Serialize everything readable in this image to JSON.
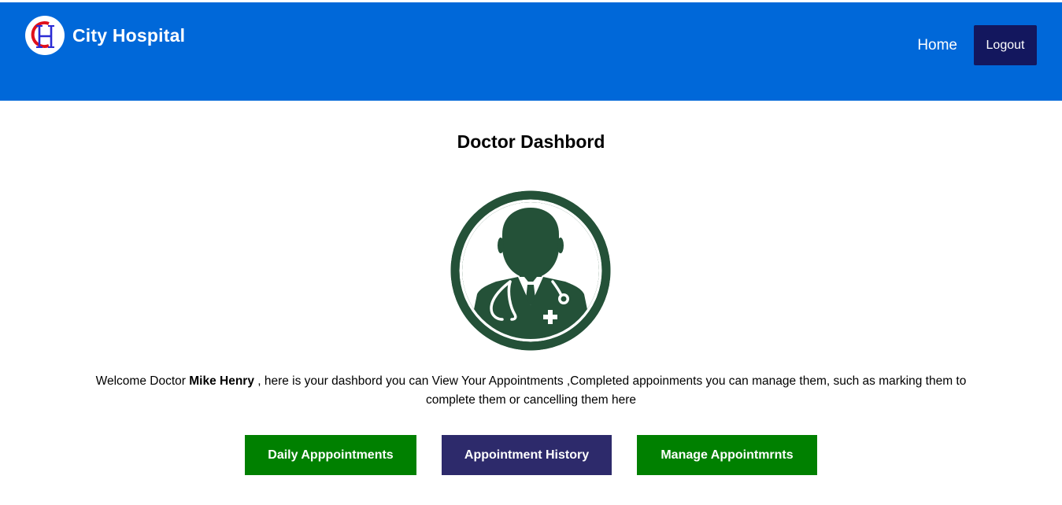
{
  "colors": {
    "navbar": "#0068d9",
    "logout_bg": "#13175e",
    "avatar_green": "#245138",
    "daily_btn": "#008000",
    "history_btn": "#2d2a6b",
    "manage_btn": "#008000"
  },
  "header": {
    "logo_icon": "ch-monogram-logo",
    "brand": "City Hospital",
    "nav": {
      "home": "Home",
      "logout": "Logout"
    }
  },
  "main": {
    "title": "Doctor Dashbord",
    "avatar_icon": "doctor-stethoscope-icon",
    "welcome": {
      "prefix": "Welcome Doctor ",
      "doctor_name": "Mike Henry",
      "suffix": " , here is your dashbord you can View Your Appointments ,Completed appoinments you can manage them, such as marking them to complete them or cancelling them here"
    },
    "buttons": {
      "daily": "Daily Apppointments",
      "history": "Appointment History",
      "manage": "Manage Appointmrnts"
    }
  }
}
